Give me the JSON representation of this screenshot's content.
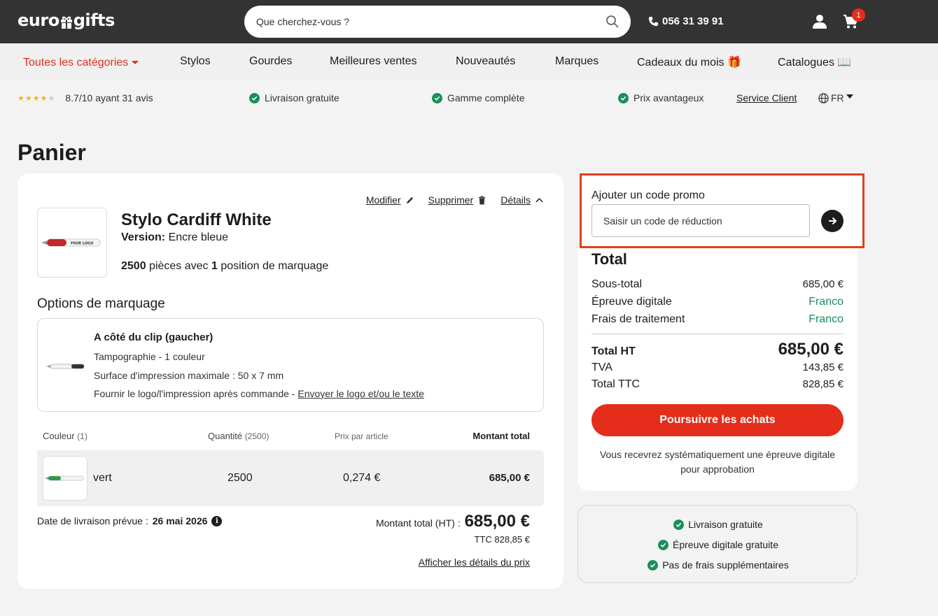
{
  "header": {
    "logo_left": "euro",
    "logo_right": "gifts",
    "search_placeholder": "Que cherchez-vous ?",
    "phone": "056 31 39 91",
    "cart_count": "1"
  },
  "nav": {
    "items": [
      {
        "label": "Toutes les catégories"
      },
      {
        "label": "Stylos"
      },
      {
        "label": "Gourdes"
      },
      {
        "label": "Meilleures ventes"
      },
      {
        "label": "Nouveautés"
      },
      {
        "label": "Marques"
      },
      {
        "label": "Cadeaux du mois 🎁"
      },
      {
        "label": "Catalogues 📖"
      }
    ]
  },
  "trust": {
    "rating": "8.7/10 ayant 31 avis",
    "rating_stars": 4.35,
    "items": [
      "Livraison gratuite",
      "Gamme complète",
      "Prix avantageux"
    ],
    "service": "Service Client",
    "lang": "FR"
  },
  "page": {
    "title": "Panier"
  },
  "cart": {
    "actions": {
      "edit": "Modifier",
      "delete": "Supprimer",
      "details": "Détails"
    },
    "product": {
      "title": "Stylo Cardiff White",
      "version_label": "Version:",
      "version_value": "Encre bleue",
      "qty_num": "2500",
      "qty_text": "pièces avec",
      "pos_num": "1",
      "pos_text": "position de marquage",
      "thumb_text": "YOUR LOGO"
    },
    "options_title": "Options de marquage",
    "option": {
      "title": "A côté du clip (gaucher)",
      "line1": "Tampographie - 1 couleur",
      "line2": "Surface d'impression maximale : 50 x 7 mm",
      "line3": "Fournir le logo/l'impression après commande -",
      "line3_link": "Envoyer le logo et/ou le texte"
    },
    "table": {
      "headers": {
        "color": "Couleur",
        "color_count": "(1)",
        "qty": "Quantité",
        "qty_count": "(2500)",
        "unit": "Prix par article",
        "total": "Montant total"
      },
      "rows": [
        {
          "color": "vert",
          "qty": "2500",
          "unit": "0,274 €",
          "total": "685,00 €"
        }
      ]
    },
    "delivery_label": "Date de livraison prévue :",
    "delivery_date": "26 mai 2026",
    "total_ht_label": "Montant total (HT) :",
    "total_ht_value": "685,00 €",
    "ttc_line": "TTC 828,85 €",
    "price_details": "Afficher les détails du prix"
  },
  "promo": {
    "label": "Ajouter un code promo",
    "placeholder": "Saisir un code de réduction"
  },
  "summary": {
    "title": "Total",
    "rows": [
      {
        "label": "Sous-total",
        "value": "685,00 €"
      },
      {
        "label": "Épreuve digitale",
        "value": "Franco"
      },
      {
        "label": "Frais de traitement",
        "value": "Franco"
      }
    ],
    "total_ht_label": "Total HT",
    "total_ht_value": "685,00 €",
    "tva_label": "TVA",
    "tva_value": "143,85 €",
    "ttc_label": "Total TTC",
    "ttc_value": "828,85 €",
    "cta": "Poursuivre les achats",
    "note": "Vous recevrez systématiquement une épreuve digitale pour approbation"
  },
  "benefits": [
    "Livraison gratuite",
    "Épreuve digitale gratuite",
    "Pas de frais supplémentaires"
  ],
  "colors": {
    "accent": "#e42d1b",
    "green": "#1a8f5a",
    "header": "#333333",
    "highlight": "#e0401c"
  }
}
